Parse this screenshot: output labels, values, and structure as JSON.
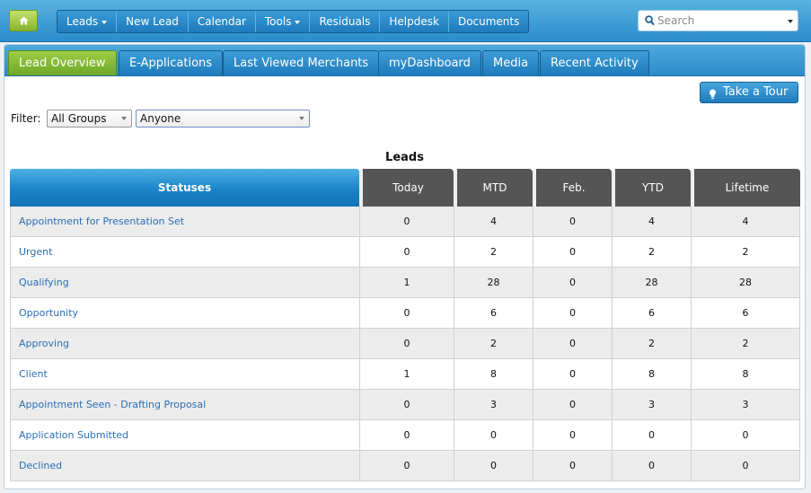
{
  "nav": {
    "items": [
      {
        "label": "Leads",
        "dropdown": true
      },
      {
        "label": "New Lead",
        "dropdown": false
      },
      {
        "label": "Calendar",
        "dropdown": false
      },
      {
        "label": "Tools",
        "dropdown": true
      },
      {
        "label": "Residuals",
        "dropdown": false
      },
      {
        "label": "Helpdesk",
        "dropdown": false
      },
      {
        "label": "Documents",
        "dropdown": false
      }
    ],
    "search_placeholder": "Search"
  },
  "tabs": [
    {
      "label": "Lead Overview",
      "active": true
    },
    {
      "label": "E-Applications",
      "active": false
    },
    {
      "label": "Last Viewed Merchants",
      "active": false
    },
    {
      "label": "myDashboard",
      "active": false
    },
    {
      "label": "Media",
      "active": false
    },
    {
      "label": "Recent Activity",
      "active": false
    }
  ],
  "filter": {
    "label": "Filter:",
    "group_value": "All Groups",
    "person_value": "Anyone"
  },
  "tour_button": "Take a Tour",
  "leads_title": "Leads",
  "table": {
    "headers": [
      "Statuses",
      "Today",
      "MTD",
      "Feb.",
      "YTD",
      "Lifetime"
    ],
    "rows": [
      {
        "status": "Appointment for Presentation Set",
        "values": [
          "0",
          "4",
          "0",
          "4",
          "4"
        ]
      },
      {
        "status": "Urgent",
        "values": [
          "0",
          "2",
          "0",
          "2",
          "2"
        ]
      },
      {
        "status": "Qualifying",
        "values": [
          "1",
          "28",
          "0",
          "28",
          "28"
        ]
      },
      {
        "status": "Opportunity",
        "values": [
          "0",
          "6",
          "0",
          "6",
          "6"
        ]
      },
      {
        "status": "Approving",
        "values": [
          "0",
          "2",
          "0",
          "2",
          "2"
        ]
      },
      {
        "status": "Client",
        "values": [
          "1",
          "8",
          "0",
          "8",
          "8"
        ]
      },
      {
        "status": "Appointment Seen - Drafting Proposal",
        "values": [
          "0",
          "3",
          "0",
          "3",
          "3"
        ]
      },
      {
        "status": "Application Submitted",
        "values": [
          "0",
          "0",
          "0",
          "0",
          "0"
        ]
      },
      {
        "status": "Declined",
        "values": [
          "0",
          "0",
          "0",
          "0",
          "0"
        ]
      }
    ]
  },
  "colors": {
    "accent_blue": "#2a8ccb",
    "active_tab_green": "#86b42a",
    "header_gray": "#555555",
    "link_blue": "#2a6fb5"
  },
  "icons": {
    "home": "home-icon",
    "search": "search-icon",
    "bulb": "lightbulb-icon"
  }
}
